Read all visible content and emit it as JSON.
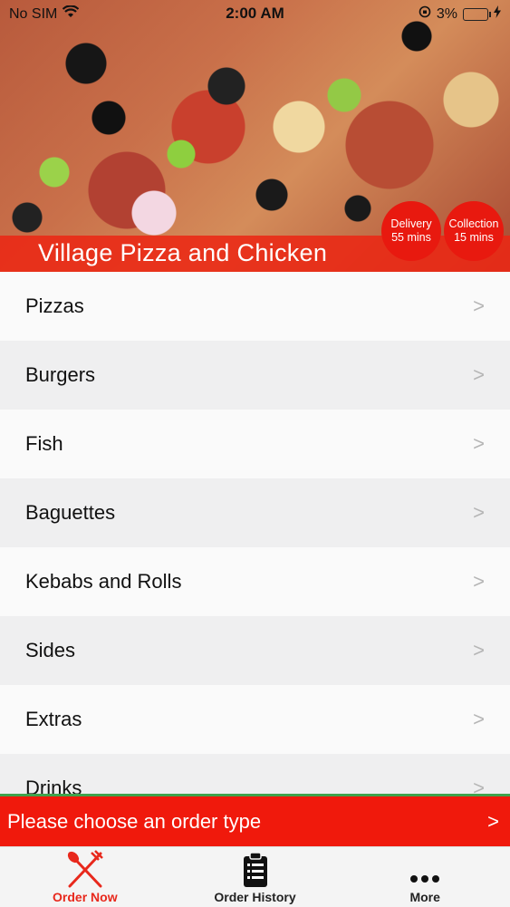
{
  "status_bar": {
    "carrier": "No SIM",
    "time": "2:00 AM",
    "battery": "3%",
    "battery_level": 0.03
  },
  "header": {
    "restaurant_name": "Village Pizza and Chicken",
    "delivery": {
      "label": "Delivery",
      "time": "55 mins"
    },
    "collection": {
      "label": "Collection",
      "time": "15 mins"
    }
  },
  "menu": {
    "items": [
      {
        "label": "Pizzas"
      },
      {
        "label": "Burgers"
      },
      {
        "label": "Fish"
      },
      {
        "label": "Baguettes"
      },
      {
        "label": "Kebabs and Rolls"
      },
      {
        "label": "Sides"
      },
      {
        "label": "Extras"
      },
      {
        "label": "Drinks"
      }
    ],
    "chevron": ">"
  },
  "order_bar": {
    "label": "Please choose an order type",
    "arrow": ">"
  },
  "tabs": [
    {
      "label": "Order Now",
      "icon": "fork-knife-icon",
      "active": true
    },
    {
      "label": "Order History",
      "icon": "clipboard-icon",
      "active": false
    },
    {
      "label": "More",
      "icon": "ellipsis-icon",
      "active": false
    }
  ],
  "colors": {
    "accent": "#e8281c",
    "order_bar": "#f0190c",
    "active_tab": "#e8281c"
  }
}
